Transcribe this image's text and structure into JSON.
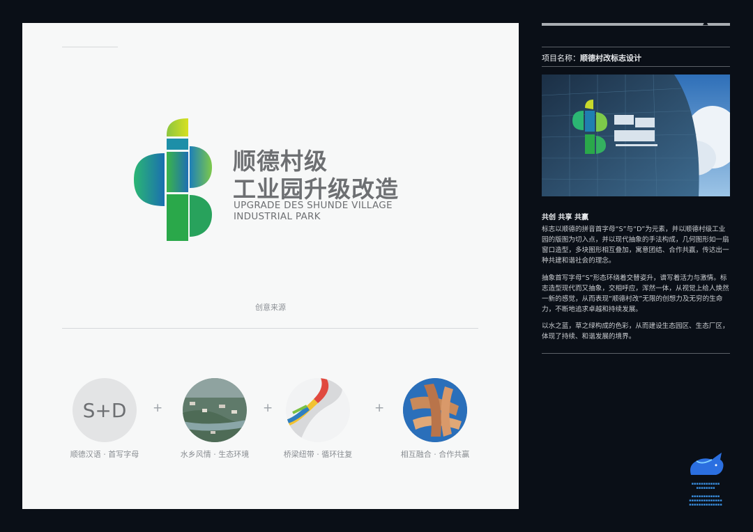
{
  "board": {
    "logo_title_line1": "顺德村级",
    "logo_title_line2": "工业园升级改造",
    "logo_en_line1": "UPGRADE DES SHUNDE VILLAGE",
    "logo_en_line2": "INDUSTRIAL PARK",
    "section_caption": "创意来源",
    "items": [
      {
        "label": "顺德汉语 · 首写字母",
        "circle_text": "S+D",
        "icon": "sd-letters"
      },
      {
        "label": "水乡风情 · 生态环境",
        "icon": "water-town-photo"
      },
      {
        "label": "桥梁纽带 · 循环往复",
        "icon": "ribbon-photo"
      },
      {
        "label": "相互融合 · 合作共赢",
        "icon": "hands-photo"
      }
    ],
    "plus": "+"
  },
  "sidebar": {
    "project_label": "项目名称：",
    "project_name": "顺德村改标志设计",
    "heading": "共创  共享  共赢",
    "para1": "标志以顺德的拼音首字母“S”与“D”为元素，并以顺德村级工业园的版图为切入点，并以现代抽象的手法构成，几何图形如一扇窗口造型，多块图形相互叠加，寓意团结、合作共赢，传达出一种共建和谐社会的理念。",
    "para2": "抽象首写字母“S”形态环绕着交替姿升，谱写着活力与激情。标志造型现代而又抽象，交相呼应，浑然一体，从视觉上给人焕然一新的感觉，从而表现“顺德村改”无限的创想力及无穷的生命力，不断地追求卓越和持续发展。",
    "para3": "以水之蓝，草之绿构成的色彩，从而建设生态园区、生态厂区，体现了持续、和谐发展的境界。"
  },
  "colors": {
    "background": "#0a0f17",
    "board": "#f7f8f8",
    "logo_green": "#3bb54a",
    "logo_blue": "#1f6fb2",
    "logo_yellow": "#c8d92b"
  }
}
